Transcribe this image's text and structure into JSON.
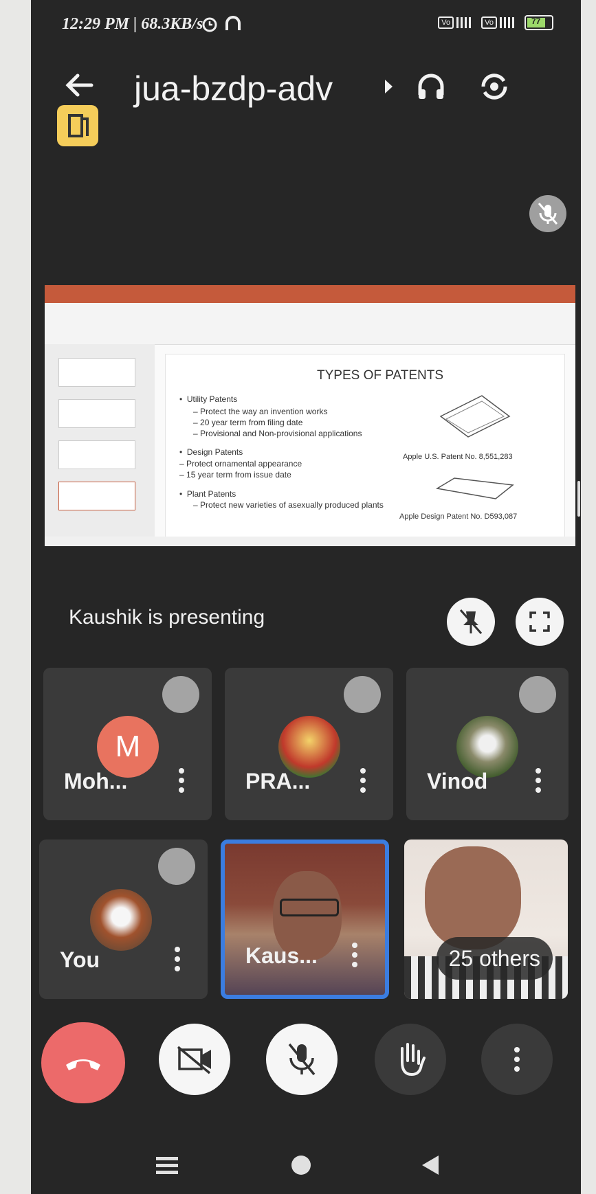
{
  "status_bar": {
    "time": "12:29 PM | 68.3KB/s",
    "battery": "77"
  },
  "header": {
    "meeting_code": "jua-bzdp-adv"
  },
  "presentation": {
    "slide_title": "TYPES OF PATENTS",
    "bullets": [
      "Utility Patents",
      "Protect the way an invention works",
      "20 year term from filing date",
      "Provisional and Non-provisional applications",
      "Design Patents",
      "Protect ornamental appearance",
      "15 year term from issue date",
      "Plant Patents",
      "Protect new varieties of asexually produced plants"
    ],
    "caption_1": "Apple U.S. Patent No. 8,551,283",
    "caption_2": "Apple Design Patent No. D593,087",
    "presenting_text": "Kaushik is presenting"
  },
  "participants": [
    {
      "name": "Moh...",
      "initial": "M",
      "avatar_color": "#e8735f"
    },
    {
      "name": "PRA..."
    },
    {
      "name": "Vinod"
    },
    {
      "name": "You"
    },
    {
      "name": "Kaus..."
    },
    {
      "others_label": "25 others"
    }
  ],
  "colors": {
    "end_call": "#ec6a6a",
    "active_border": "#3b7de0",
    "doc_badge": "#f5cd5a"
  }
}
